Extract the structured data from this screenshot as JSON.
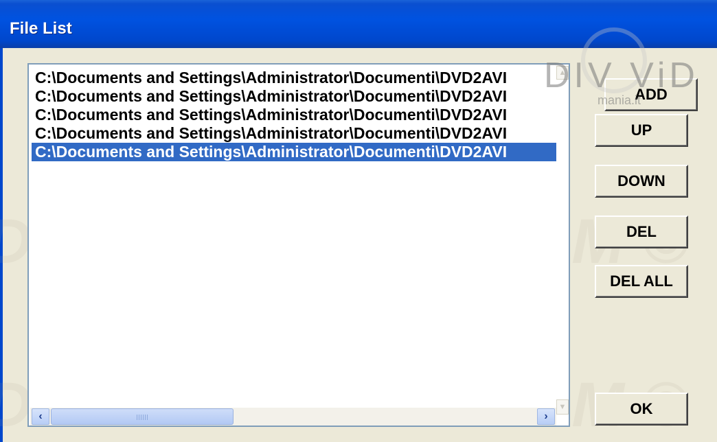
{
  "window": {
    "title": "File List",
    "title_bar_color": "#0052e0"
  },
  "file_list": {
    "items": [
      {
        "path": "C:\\Documents and Settings\\Administrator\\Documenti\\DVD2AVI"
      },
      {
        "path": "C:\\Documents and Settings\\Administrator\\Documenti\\DVD2AVI"
      },
      {
        "path": "C:\\Documents and Settings\\Administrator\\Documenti\\DVD2AVI"
      },
      {
        "path": "C:\\Documents and Settings\\Administrator\\Documenti\\DVD2AVI"
      },
      {
        "path": "C:\\Documents and Settings\\Administrator\\Documenti\\DVD2AVI"
      }
    ],
    "selected_index": 4,
    "selection_color": "#316ac5",
    "scroll_left_icon": "chevron-left-icon",
    "scroll_right_icon": "chevron-right-icon"
  },
  "buttons": {
    "add": "ADD",
    "up": "UP",
    "down": "DOWN",
    "del": "DEL",
    "del_all": "DEL ALL",
    "ok": "OK"
  },
  "watermark": {
    "text": "DM © DM © DM © DM ©",
    "logo_main": "DIV  ViD",
    "logo_sub": "mania.it"
  }
}
